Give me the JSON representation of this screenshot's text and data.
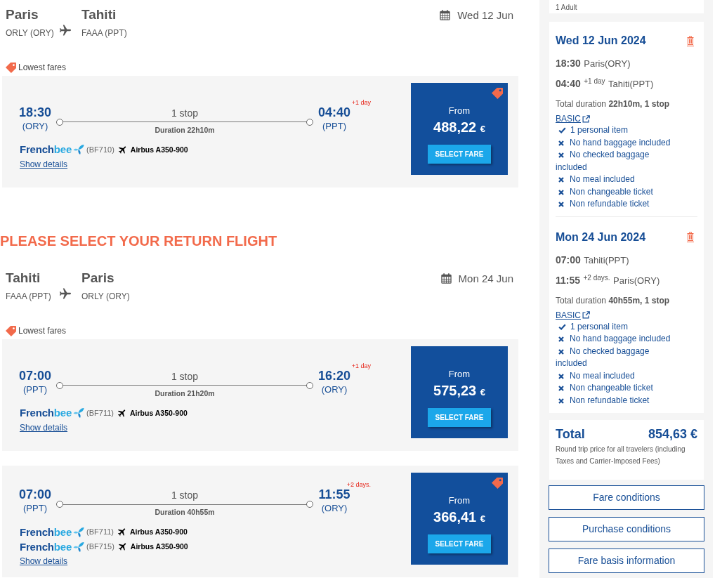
{
  "journeys": [
    {
      "route": {
        "from_city": "Paris",
        "from_airport": "ORLY (ORY)",
        "to_city": "Tahiti",
        "to_airport": "FAAA (PPT)",
        "date": "Wed 12 Jun"
      },
      "fares_label": "Lowest fares",
      "flights": [
        {
          "departure_time": "18:30",
          "departure_airport": "(ORY)",
          "stops": "1 stop",
          "duration": "Duration 22h10m",
          "arrival_time": "04:40",
          "arrival_airport": "(PPT)",
          "day_offset": "+1 day",
          "segments": [
            {
              "logo": [
                "French",
                "bee"
              ],
              "flight_number": "(BF710)",
              "aircraft": "Airbus A350-900"
            }
          ],
          "details_link": "Show details",
          "price_label": "From",
          "price": "488,22",
          "currency": "€",
          "lowest_fare": true,
          "button": "SELECT FARE"
        }
      ]
    },
    {
      "heading": "PLEASE SELECT YOUR RETURN FLIGHT",
      "route": {
        "from_city": "Tahiti",
        "from_airport": "FAAA (PPT)",
        "to_city": "Paris",
        "to_airport": "ORLY (ORY)",
        "date": "Mon 24 Jun"
      },
      "fares_label": "Lowest fares",
      "flights": [
        {
          "departure_time": "07:00",
          "departure_airport": "(PPT)",
          "stops": "1 stop",
          "duration": "Duration 21h20m",
          "arrival_time": "16:20",
          "arrival_airport": "(ORY)",
          "day_offset": "+1 day",
          "segments": [
            {
              "logo": [
                "French",
                "bee"
              ],
              "flight_number": "(BF711)",
              "aircraft": "Airbus A350-900"
            }
          ],
          "details_link": "Show details",
          "price_label": "From",
          "price": "575,23",
          "currency": "€",
          "lowest_fare": false,
          "button": "SELECT FARE"
        },
        {
          "departure_time": "07:00",
          "departure_airport": "(PPT)",
          "stops": "1 stop",
          "duration": "Duration 40h55m",
          "arrival_time": "11:55",
          "arrival_airport": "(ORY)",
          "day_offset": "+2 days.",
          "segments": [
            {
              "logo": [
                "French",
                "bee"
              ],
              "flight_number": "(BF711)",
              "aircraft": "Airbus A350-900"
            },
            {
              "logo": [
                "French",
                "bee"
              ],
              "flight_number": "(BF715)",
              "aircraft": "Airbus A350-900"
            }
          ],
          "details_link": "Show details",
          "price_label": "From",
          "price": "366,41",
          "currency": "€",
          "lowest_fare": true,
          "button": "SELECT FARE"
        }
      ]
    }
  ],
  "summary": {
    "passengers": "1 Adult",
    "legs": [
      {
        "date": "Wed 12 Jun 2024",
        "departure": {
          "time": "18:30",
          "place": "Paris(ORY)"
        },
        "arrival": {
          "time": "04:40",
          "day_offset": "+1 day",
          "place": "Tahiti(PPT)"
        },
        "duration": "Total duration **22h10m, 1 stop**",
        "fare_link": "BASIC",
        "features": [
          {
            "text": "1 personal item",
            "included": true
          },
          {
            "text": "No hand baggage included",
            "included": false
          },
          {
            "text": "No checked baggage included",
            "included": false
          },
          {
            "text": "No meal included",
            "included": false
          },
          {
            "text": "Non changeable ticket",
            "included": false
          },
          {
            "text": "Non refundable ticket",
            "included": false
          }
        ]
      },
      {
        "date": "Mon 24 Jun 2024",
        "departure": {
          "time": "07:00",
          "place": "Tahiti(PPT)"
        },
        "arrival": {
          "time": "11:55",
          "day_offset": "+2 days.",
          "place": "Paris(ORY)"
        },
        "duration": "Total duration **40h55m, 1 stop**",
        "fare_link": "BASIC",
        "features": [
          {
            "text": "1 personal item",
            "included": true
          },
          {
            "text": "No hand baggage included",
            "included": false
          },
          {
            "text": "No checked baggage included",
            "included": false
          },
          {
            "text": "No meal included",
            "included": false
          },
          {
            "text": "Non changeable ticket",
            "included": false
          },
          {
            "text": "Non refundable ticket",
            "included": false
          }
        ]
      }
    ],
    "total": {
      "label": "Total",
      "amount": "854,63 €",
      "note": "Round trip price for all travelers (including Taxes and Carrier-Imposed Fees)"
    },
    "buttons": [
      "Fare conditions",
      "Purchase conditions",
      "Fare basis information"
    ]
  }
}
